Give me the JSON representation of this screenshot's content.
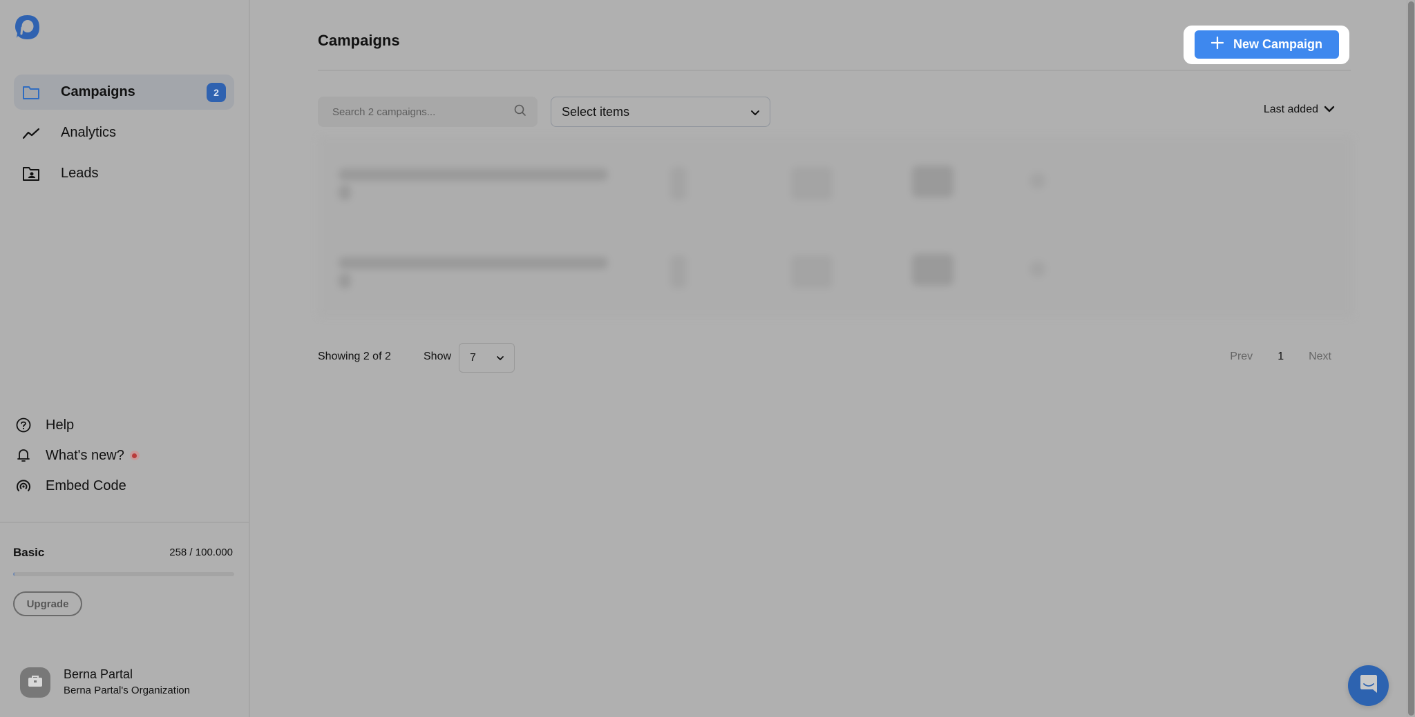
{
  "sidebar": {
    "logo_icon": "app-logo-icon",
    "nav": [
      {
        "label": "Campaigns",
        "icon": "folder-icon",
        "badge": "2",
        "active": true
      },
      {
        "label": "Analytics",
        "icon": "trend-line-icon"
      },
      {
        "label": "Leads",
        "icon": "contact-folder-icon"
      }
    ],
    "utility": [
      {
        "label": "Help",
        "icon": "help-circle-icon"
      },
      {
        "label": "What's new?",
        "icon": "bell-icon",
        "has_notification": true
      },
      {
        "label": "Embed Code",
        "icon": "broadcast-icon"
      }
    ],
    "plan": {
      "name": "Basic",
      "usage_text": "258 / 100.000",
      "usage_fraction": 0.00258,
      "upgrade_label": "Upgrade"
    },
    "user": {
      "name": "Berna Partal",
      "organization": "Berna Partal's Organization",
      "avatar_icon": "briefcase-icon"
    }
  },
  "main": {
    "title": "Campaigns",
    "new_campaign_label": "New Campaign",
    "search": {
      "placeholder": "Search 2 campaigns...",
      "value": ""
    },
    "filter_select": {
      "value": "Select items"
    },
    "sort": {
      "value": "Last added"
    },
    "table": {
      "rows_count": 2,
      "content_state": "blurred"
    },
    "footer": {
      "showing": "Showing 2 of 2",
      "show_label": "Show",
      "per_page": "7",
      "prev_label": "Prev",
      "current_page": "1",
      "next_label": "Next"
    }
  },
  "colors": {
    "accent": "#3e88ee",
    "badge": "#2f62b0",
    "overlay_bg": "#b0b0b0",
    "notification": "#b93a3a"
  }
}
